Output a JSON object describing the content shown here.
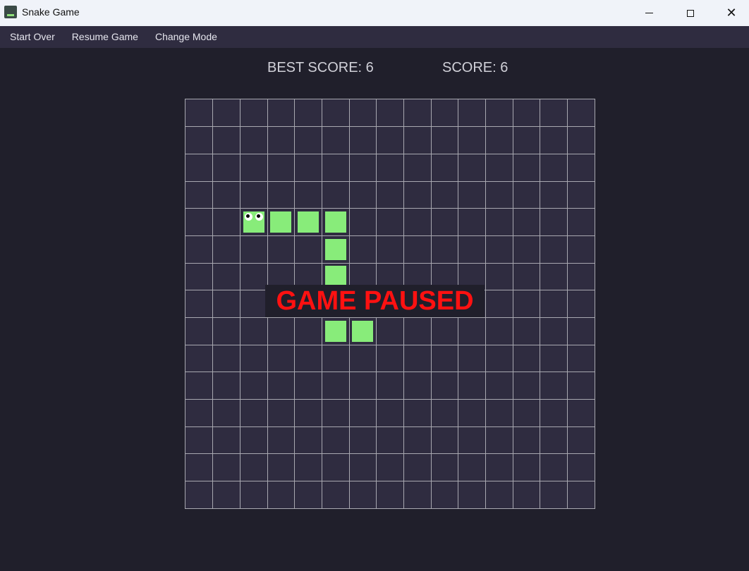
{
  "window": {
    "title": "Snake Game",
    "icon": "snake-app-icon",
    "controls": {
      "minimize": "minimize-icon",
      "maximize": "maximize-icon",
      "close": "close-icon"
    }
  },
  "menu": {
    "items": [
      {
        "label": "Start Over"
      },
      {
        "label": "Resume Game"
      },
      {
        "label": "Change Mode"
      }
    ]
  },
  "scores": {
    "best": "BEST SCORE: 6",
    "current": "SCORE: 6"
  },
  "board": {
    "columns": 15,
    "rows": 15,
    "snake_head": {
      "col": 2,
      "row": 4,
      "direction": "left"
    },
    "snake_body": [
      {
        "col": 3,
        "row": 4
      },
      {
        "col": 4,
        "row": 4
      },
      {
        "col": 5,
        "row": 4
      },
      {
        "col": 5,
        "row": 5
      },
      {
        "col": 5,
        "row": 6
      },
      {
        "col": 5,
        "row": 7
      },
      {
        "col": 5,
        "row": 8
      },
      {
        "col": 6,
        "row": 8
      }
    ]
  },
  "status": {
    "message": "GAME PAUSED",
    "color": "#ff1111"
  },
  "colors": {
    "background": "#201f2b",
    "board": "#2f2c40",
    "grid": "#a8a8b0",
    "snake": "#88ec7a"
  }
}
